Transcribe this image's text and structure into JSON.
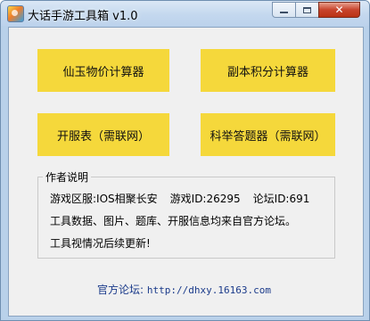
{
  "window": {
    "title": "大话手游工具箱 v1.0",
    "icon": "app-icon",
    "controls": {
      "minimize": "minimize-icon",
      "maximize": "maximize-icon",
      "close": "✕"
    }
  },
  "buttons": [
    {
      "label": "仙玉物价计算器"
    },
    {
      "label": "副本积分计算器"
    },
    {
      "label": "开服表（需联网）"
    },
    {
      "label": "科举答题器（需联网）"
    }
  ],
  "author_notes": {
    "title": "作者说明",
    "server_label": "游戏区服:IOS相聚长安",
    "game_id_label": "游戏ID:26295",
    "forum_id_label": "论坛ID:691",
    "line2": "工具数据、图片、题库、开服信息均来自官方论坛。",
    "line3": "工具视情况后续更新!"
  },
  "footer": {
    "forum_label": "官方论坛:",
    "forum_url": "http://dhxy.16163.com"
  },
  "colors": {
    "button_yellow": "#f5d83b",
    "link_blue": "#1a3a8a",
    "client_bg": "#f0f0f0"
  }
}
